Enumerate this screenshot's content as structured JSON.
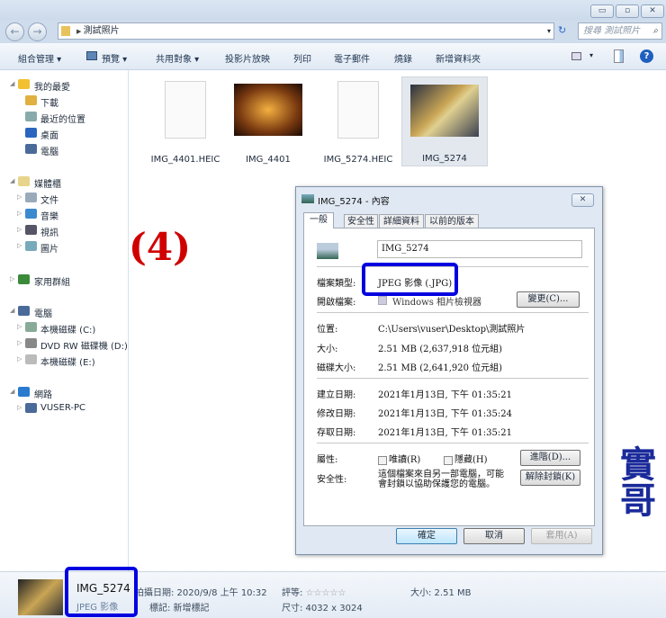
{
  "window": {
    "minimize": "▭",
    "maximize": "▫",
    "close": "✕"
  },
  "address": {
    "path": "測試照片",
    "search_placeholder": "搜尋 測試照片"
  },
  "toolbar": {
    "organize": "組合管理 ▾",
    "preview": "預覽 ▾",
    "share": "共用對象 ▾",
    "slideshow": "投影片放映",
    "print": "列印",
    "email": "電子郵件",
    "burn": "燒錄",
    "new_folder": "新增資料夾"
  },
  "sidebar": {
    "items": [
      {
        "label": "我的最愛",
        "level": 0
      },
      {
        "label": "下載",
        "level": 1
      },
      {
        "label": "最近的位置",
        "level": 1
      },
      {
        "label": "桌面",
        "level": 1
      },
      {
        "label": "電腦",
        "level": 1
      },
      {
        "label": "媒體櫃",
        "level": 0
      },
      {
        "label": "文件",
        "level": 1
      },
      {
        "label": "音樂",
        "level": 1
      },
      {
        "label": "視訊",
        "level": 1
      },
      {
        "label": "圖片",
        "level": 1
      },
      {
        "label": "家用群組",
        "level": 0
      },
      {
        "label": "電腦",
        "level": 0
      },
      {
        "label": "本機磁碟 (C:)",
        "level": 1
      },
      {
        "label": "DVD RW 磁碟機 (D:)",
        "level": 1
      },
      {
        "label": "本機磁碟 (E:)",
        "level": 1
      },
      {
        "label": "網路",
        "level": 0
      },
      {
        "label": "VUSER-PC",
        "level": 1
      }
    ]
  },
  "files": [
    {
      "name": "IMG_4401.HEIC"
    },
    {
      "name": "IMG_4401"
    },
    {
      "name": "IMG_5274.HEIC"
    },
    {
      "name": "IMG_5274"
    }
  ],
  "annotation": {
    "step": "(4)",
    "signature": "實哥"
  },
  "dialog": {
    "title": "IMG_5274 - 內容",
    "tabs": [
      "一般",
      "安全性",
      "詳細資料",
      "以前的版本"
    ],
    "filename": "IMG_5274",
    "type_label": "檔案類型:",
    "type_value": "JPEG 影像 (.JPG)",
    "opens_label": "開啟檔案:",
    "opens_value": "Windows 相片檢視器",
    "change_button": "變更(C)...",
    "location_label": "位置:",
    "location_value": "C:\\Users\\vuser\\Desktop\\測試照片",
    "size_label": "大小:",
    "size_value": "2.51 MB (2,637,918 位元組)",
    "disk_size_label": "磁碟大小:",
    "disk_size_value": "2.51 MB (2,641,920 位元組)",
    "created_label": "建立日期:",
    "created_value": "2021年1月13日, 下午 01:35:21",
    "modified_label": "修改日期:",
    "modified_value": "2021年1月13日, 下午 01:35:24",
    "accessed_label": "存取日期:",
    "accessed_value": "2021年1月13日, 下午 01:35:21",
    "attributes_label": "屬性:",
    "readonly": "唯讀(R)",
    "hidden": "隱藏(H)",
    "advanced_button": "進階(D)...",
    "security_label": "安全性:",
    "security_line1": "這個檔案來自另一部電腦，可能",
    "security_line2": "會封鎖以協助保護您的電腦。",
    "unblock_button": "解除封鎖(K)",
    "ok": "確定",
    "cancel": "取消",
    "apply": "套用(A)"
  },
  "status": {
    "name": "IMG_5274",
    "type": "JPEG 影像",
    "date_taken": "拍攝日期: 2020/9/8 上午 10:32",
    "tags": "標記: 新增標記",
    "rating_label": "評等:",
    "rating_stars": "☆☆☆☆☆",
    "dimensions": "尺寸: 4032 x 3024",
    "size": "大小: 2.51 MB"
  }
}
